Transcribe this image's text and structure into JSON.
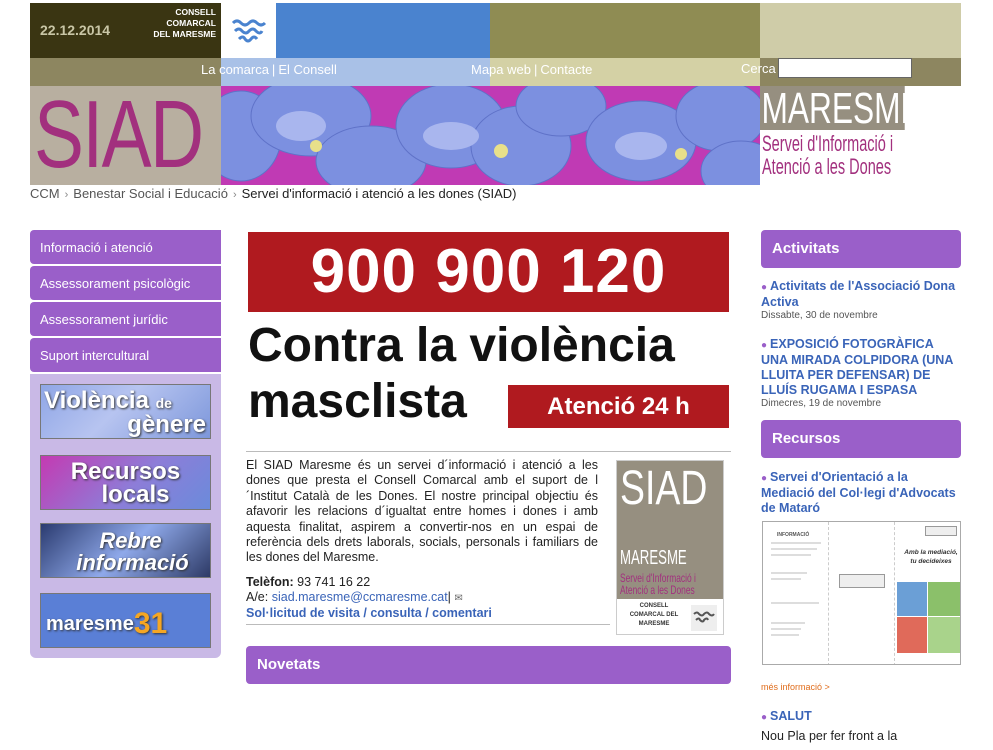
{
  "header": {
    "date": "22.12.2014",
    "org_logo_text": "CONSELL COMARCAL DEL MARESME",
    "nav_left": [
      "La comarca",
      "El Consell"
    ],
    "nav_right": [
      "Mapa web",
      "Contacte"
    ],
    "search_label": "Cerca",
    "search_value": "",
    "banner_left_text": "SIAD",
    "banner_right_title": "MARESME",
    "banner_right_sub1": "Servei d'Informació i",
    "banner_right_sub2": "Atenció a les Dones"
  },
  "breadcrumb": {
    "items": [
      "CCM",
      "Benestar Social i Educació"
    ],
    "current": "Servei d'informació i atenció a les dones (SIAD)"
  },
  "left_nav": {
    "items": [
      "Informació i atenció",
      "Assessorament psicològic",
      "Assessorament jurídic",
      "Suport intercultural"
    ]
  },
  "promos": {
    "violencia_1": "Violència",
    "violencia_de": "de",
    "violencia_2": "gènere",
    "recursos_1": "Recursos",
    "recursos_2": "locals",
    "rebre_1": "Rebre",
    "rebre_2": "informació",
    "maresme_word": "maresme",
    "maresme_num": "31"
  },
  "main": {
    "hotline": "900 900 120",
    "headline_1": "Contra la violència",
    "headline_2": "masclista",
    "badge_24h": "Atenció 24 h",
    "intro": "El SIAD Maresme és un servei d´informació i atenció a les dones que presta el Consell Comarcal amb el suport de l´Institut Català de les Dones. El nostre principal objectiu és afavorir les relacions d´igualtat entre homes i dones i amb aquesta finalitat, aspirem a convertir-nos en un espai de referència dels drets laborals, socials, personals i familiars de les dones del Maresme.",
    "phone_label": "Telèfon:",
    "phone": "93 741 16 22",
    "email_label": "A/e:",
    "email": "siad.maresme@ccmaresme.cat",
    "email_sep": "|",
    "request_link": "Sol·licitud de visita / consulta / comentari",
    "novetats": "Novetats",
    "logo_siad": "SIAD",
    "logo_maresme": "MARESME",
    "logo_sub1": "Servei d'Informació i",
    "logo_sub2": "Atenció a les Dones",
    "logo_org": "CONSELL COMARCAL DEL MARESME"
  },
  "right": {
    "activitats_title": "Activitats",
    "activitats": [
      {
        "title": "Activitats de l'Associació Dona Activa",
        "date": "Dissabte, 30 de novembre"
      },
      {
        "title": "EXPOSICIÓ FOTOGRÀFICA UNA MIRADA COLPIDORA (UNA LLUITA PER DEFENSAR) DE LLUÍS RUGAMA I ESPASA",
        "date": "Dimecres, 19 de novembre"
      }
    ],
    "recursos_title": "Recursos",
    "recurs_1": "Servei d'Orientació a la Mediació del Col·legi d'Advocats de Mataró",
    "brochure_title": "INFORMACIÓ",
    "brochure_tagline_1": "Amb la mediació,",
    "brochure_tagline_2": "tu decideixes",
    "more_info": "més informació >",
    "salut_title": "SALUT",
    "salut_text": "Nou Pla per fer front a la"
  },
  "colors": {
    "accent_purple": "#9a5fc9",
    "hotline_red": "#b01a1f",
    "link_blue": "#3a64b8",
    "siad_magenta": "#a2307e"
  }
}
